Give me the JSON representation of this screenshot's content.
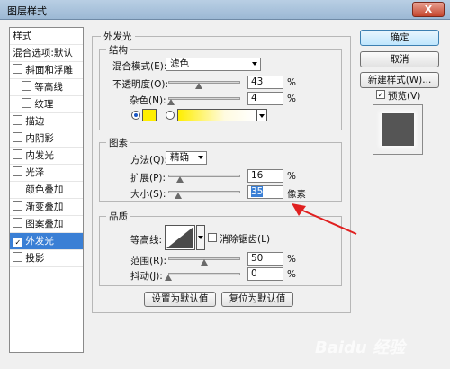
{
  "window": {
    "title": "图层样式",
    "close_symbol": "X"
  },
  "style_list": {
    "items": [
      {
        "label": "样式",
        "checkbox": false,
        "checked": false,
        "selected": false
      },
      {
        "label": "混合选项:默认",
        "checkbox": false,
        "checked": false,
        "selected": false
      },
      {
        "label": "斜面和浮雕",
        "checkbox": true,
        "checked": false,
        "selected": false
      },
      {
        "label": "等高线",
        "checkbox": true,
        "checked": false,
        "selected": false
      },
      {
        "label": "纹理",
        "checkbox": true,
        "checked": false,
        "selected": false
      },
      {
        "label": "描边",
        "checkbox": true,
        "checked": false,
        "selected": false
      },
      {
        "label": "内阴影",
        "checkbox": true,
        "checked": false,
        "selected": false
      },
      {
        "label": "内发光",
        "checkbox": true,
        "checked": false,
        "selected": false
      },
      {
        "label": "光泽",
        "checkbox": true,
        "checked": false,
        "selected": false
      },
      {
        "label": "颜色叠加",
        "checkbox": true,
        "checked": false,
        "selected": false
      },
      {
        "label": "渐变叠加",
        "checkbox": true,
        "checked": false,
        "selected": false
      },
      {
        "label": "图案叠加",
        "checkbox": true,
        "checked": false,
        "selected": false
      },
      {
        "label": "外发光",
        "checkbox": true,
        "checked": true,
        "selected": true
      },
      {
        "label": "投影",
        "checkbox": true,
        "checked": false,
        "selected": false
      }
    ]
  },
  "outer_glow": {
    "section_title": "外发光",
    "structure": {
      "title": "结构",
      "blend_mode_label": "混合模式(E):",
      "blend_mode_value": "滤色",
      "opacity_label": "不透明度(O):",
      "opacity_value": "43",
      "noise_label": "杂色(N):",
      "noise_value": "4",
      "percent": "%",
      "glow_color": "#ffee00"
    },
    "elements": {
      "title": "图素",
      "technique_label": "方法(Q):",
      "technique_value": "精确",
      "spread_label": "扩展(P):",
      "spread_value": "16",
      "size_label": "大小(S):",
      "size_value": "35",
      "percent": "%",
      "px_unit": "像素"
    },
    "quality": {
      "title": "品质",
      "contour_label": "等高线:",
      "antialias_label": "消除锯齿(L)",
      "range_label": "范围(R):",
      "range_value": "50",
      "jitter_label": "抖动(J):",
      "jitter_value": "0",
      "percent": "%"
    },
    "set_default_button": "设置为默认值",
    "reset_default_button": "复位为默认值"
  },
  "actions": {
    "ok": "确定",
    "cancel": "取消",
    "new_style": "新建样式(W)...",
    "preview_label": "预览(V)",
    "preview_checked": true
  },
  "slider_levels": {
    "opacity": 0.43,
    "noise": 0.04,
    "spread": 0.16,
    "size": 0.14,
    "range": 0.5,
    "jitter": 0.0
  },
  "annotation": {
    "arrow_color": "#e02020"
  },
  "watermark": "Baidu 经验"
}
